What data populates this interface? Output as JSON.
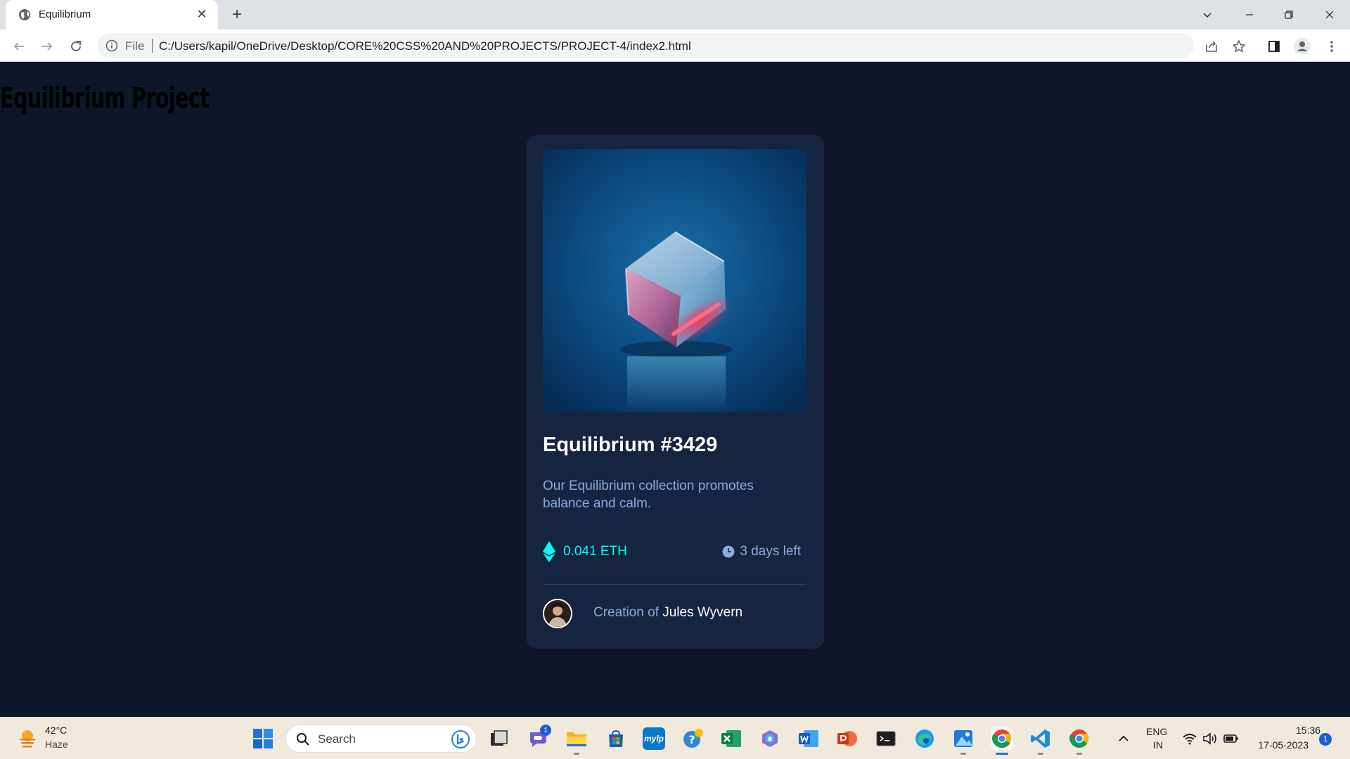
{
  "browser": {
    "tab_title": "Equilibrium",
    "close_glyph": "✕",
    "new_tab_glyph": "+",
    "omnibox_scheme": "File",
    "url": "C:/Users/kapil/OneDrive/Desktop/CORE%20CSS%20AND%20PROJECTS/PROJECT-4/index2.html",
    "icons": [
      "globe-icon",
      "back-arrow-icon",
      "forward-arrow-icon",
      "reload-icon",
      "info-icon",
      "share-icon",
      "star-icon",
      "side-panel-icon",
      "profile-icon",
      "kebab-menu-icon",
      "chevron-down-icon",
      "minimize-icon",
      "restore-icon",
      "close-window-icon"
    ]
  },
  "page": {
    "heading": "Equilibrium Project"
  },
  "card": {
    "title": "Equilibrium #3429",
    "description": "Our Equilibrium collection promotes balance and calm.",
    "price": "0.041 ETH",
    "time_left": "3 days left",
    "creator_prefix": "Creation of",
    "creator_name": "Jules Wyvern",
    "colors": {
      "card_bg": "#15243f",
      "page_bg": "#0d1729",
      "cyan": "#00fff8",
      "soft_blue": "#8bacd9"
    }
  },
  "taskbar": {
    "weather_temp": "42°C",
    "weather_condition": "Haze",
    "search_placeholder": "Search",
    "teams_badge": "1",
    "lang_primary": "ENG",
    "lang_secondary": "IN",
    "time": "15:36",
    "date": "17-05-2023",
    "notification_count": "1",
    "mylo_label": "mylp",
    "apps": [
      "start",
      "search",
      "bing",
      "task-view",
      "teams-chat",
      "file-explorer",
      "microsoft-store",
      "mylp",
      "get-help",
      "excel",
      "copilot",
      "word",
      "powerpoint",
      "terminal",
      "edge",
      "photos",
      "chrome",
      "vscode",
      "chrome-2"
    ]
  }
}
